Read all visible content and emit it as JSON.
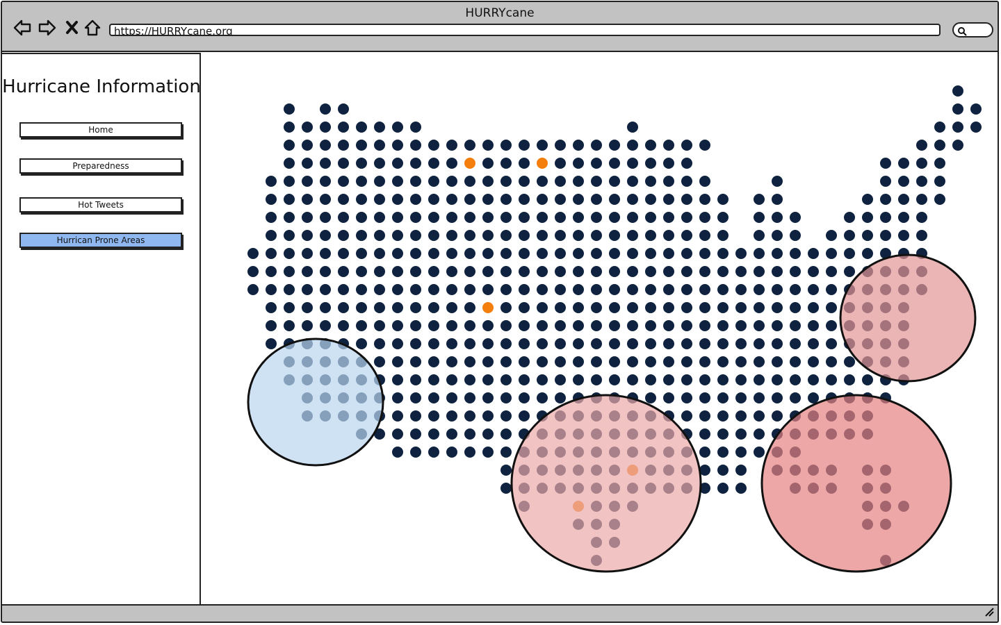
{
  "window": {
    "title": "HURRYcane"
  },
  "browser": {
    "url": "https://HURRYcane.org",
    "icons": [
      "back-arrow-icon",
      "forward-arrow-icon",
      "close-x-icon",
      "home-icon",
      "search-icon"
    ]
  },
  "sidebar": {
    "title": "Hurricane Information",
    "items": [
      {
        "label": "Home",
        "active": false
      },
      {
        "label": "Preparedness",
        "active": false
      },
      {
        "label": "Hot Tweets",
        "active": false
      },
      {
        "label": "Hurrican Prone Areas",
        "active": true
      }
    ]
  },
  "map": {
    "dot_color": "#0f2340",
    "highlight_color": "#f57f0c",
    "zones": [
      {
        "color": "#b9d5f0"
      },
      {
        "color": "#eba9a9"
      },
      {
        "color": "#e58181"
      },
      {
        "color": "#e49595"
      }
    ]
  },
  "colors": {
    "chrome": "#c2c2c2",
    "active_button": "#8fb8f0",
    "outline": "#222222"
  }
}
